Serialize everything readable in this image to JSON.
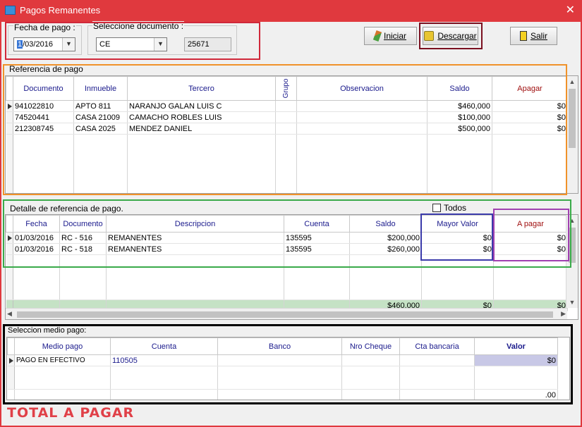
{
  "window": {
    "title": "Pagos Remanentes",
    "close_glyph": "✕"
  },
  "header": {
    "fecha_label": "Fecha de pago :",
    "fecha_value_prefix": "1",
    "fecha_value_rest": "/03/2016",
    "doc_label": "Seleccione documento :",
    "doc_value": "CE",
    "doc_number": "25671"
  },
  "buttons": {
    "iniciar": "Iniciar",
    "descargar": "Descargar",
    "salir": "Salir"
  },
  "referencia": {
    "title": "Referencia de pago",
    "columns": [
      "Documento",
      "Inmueble",
      "Tercero",
      "Grupo",
      "Observacion",
      "Saldo",
      "Apagar"
    ],
    "rows": [
      [
        "941022810",
        "APTO 811",
        "NARANJO GALAN LUIS C",
        "",
        "",
        "$460,000",
        "$0"
      ],
      [
        "74520441",
        "CASA 21009",
        "CAMACHO ROBLES LUIS",
        "",
        "",
        "$100,000",
        "$0"
      ],
      [
        "212308745",
        "CASA 2025",
        "MENDEZ  DANIEL",
        "",
        "",
        "$500,000",
        "$0"
      ]
    ]
  },
  "detalle": {
    "title": "Detalle de referencia de pago.",
    "todos_label": "Todos",
    "columns": [
      "Fecha",
      "Documento",
      "Descripcion",
      "Cuenta",
      "Saldo",
      "Mayor Valor",
      "A pagar"
    ],
    "rows": [
      [
        "01/03/2016",
        "RC - 516",
        "REMANENTES",
        "135595",
        "$200,000",
        "$0",
        "$0"
      ],
      [
        "01/03/2016",
        "RC - 518",
        "REMANENTES",
        "135595",
        "$260,000",
        "$0",
        "$0"
      ]
    ],
    "totals": {
      "saldo": "$460,000",
      "mayor_valor": "$0",
      "a_pagar": "$0"
    }
  },
  "medio": {
    "title": "Seleccion medio pago:",
    "columns": [
      "Medio pago",
      "Cuenta",
      "Banco",
      "Nro Cheque",
      "Cta bancaria",
      "Valor"
    ],
    "rows": [
      [
        "PAGO EN EFECTIVO",
        "110505",
        "",
        "",
        "",
        "$0"
      ]
    ],
    "footer_total": ".00"
  },
  "total_label": "TOTAL A PAGAR",
  "colors": {
    "title_bar": "#e0393e",
    "orange": "#f0922a",
    "green": "#3aaa4a",
    "black": "#000000",
    "maroon": "#7a1020",
    "red_box": "#d0283a",
    "blue_box": "#3b3baa",
    "purple_box": "#a040b0",
    "total_text": "#e04048",
    "totals_row": "#c5e2c5",
    "valor_cell": "#c8c8e6"
  }
}
